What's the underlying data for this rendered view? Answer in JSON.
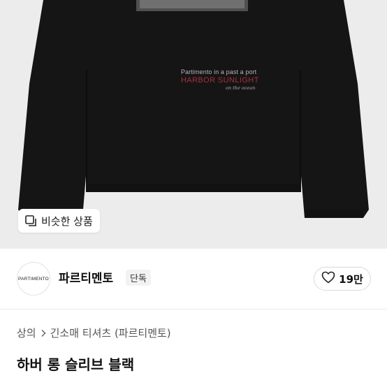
{
  "hero": {
    "print_line1": "Partimento in a past a port",
    "print_line2": "HARBOR SUNLIGHT",
    "print_line3": "on the ocean",
    "similar_button_label": "비슷한 상품",
    "similar_icon": "similar-items-icon"
  },
  "brand": {
    "logo_text": "PARTIMENTO",
    "name": "파르티멘토",
    "badge": "단독",
    "like_count": "19만",
    "like_icon": "heart-icon"
  },
  "breadcrumb": {
    "items": [
      "상의",
      "긴소매 티셔츠 (파르티멘토)"
    ],
    "separator_icon": "chevron-right-icon"
  },
  "product": {
    "title": "하버 롱 슬리브 블랙"
  },
  "colors": {
    "shirt": "#151515",
    "hero_background": "#ececec",
    "print_accent": "#a72f3e"
  }
}
